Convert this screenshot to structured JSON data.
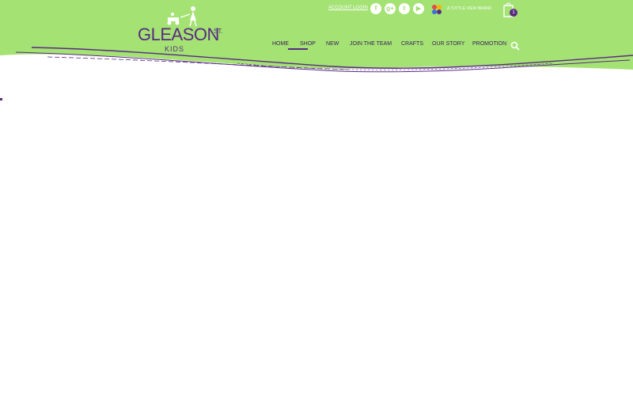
{
  "header": {
    "logo": {
      "name": "GLEASON",
      "superscript": "ST.",
      "sub": "KIDS"
    },
    "account_login": "ACCOUNT LOGIN",
    "social": [
      {
        "icon": "facebook-icon",
        "glyph": "f"
      },
      {
        "icon": "google-plus-icon",
        "glyph": "g+"
      },
      {
        "icon": "twitter-icon",
        "glyph": "t"
      },
      {
        "icon": "youtube-icon",
        "glyph": "▶"
      }
    ],
    "brand_tagline": "A TUTTLE VIEW BRAND",
    "cart_count": "1"
  },
  "nav": {
    "items": [
      {
        "label": "HOME"
      },
      {
        "label": "SHOP"
      },
      {
        "label": "NEW"
      },
      {
        "label": "JOIN THE TEAM"
      },
      {
        "label": "CRAFTS"
      },
      {
        "label": "OUR STORY"
      },
      {
        "label": "PROMOTION"
      }
    ],
    "active": "SHOP"
  },
  "colors": {
    "header_green": "#a3e273",
    "accent_purple": "#5a2a82",
    "nav_text": "#3a1d5a",
    "background": "#ffffff"
  }
}
